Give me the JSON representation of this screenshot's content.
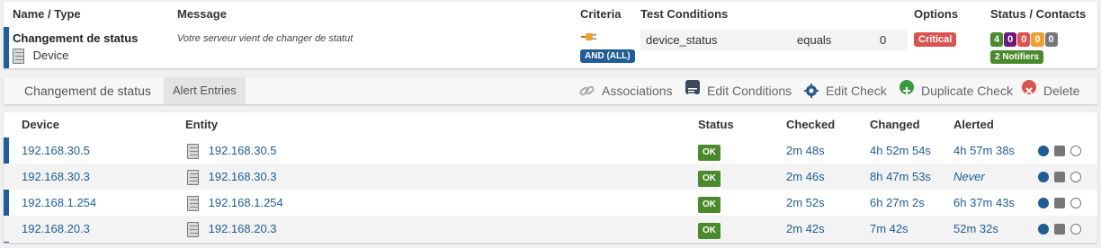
{
  "alert_check": {
    "headers": {
      "name_type": "Name / Type",
      "message": "Message",
      "criteria": "Criteria",
      "test_conditions": "Test Conditions",
      "options": "Options",
      "status_contacts": "Status / Contacts"
    },
    "name": "Changement de status",
    "type": "Device",
    "message": "Votre serveur vient de changer de statut",
    "criteria_badge": "AND (ALL)",
    "condition": {
      "field": "device_status",
      "operator": "equals",
      "value": "0"
    },
    "option_badge": "Critical",
    "status_counts": [
      {
        "value": "4",
        "color": "#4a8a2c"
      },
      {
        "value": "0",
        "color": "#6a1a7a"
      },
      {
        "value": "0",
        "color": "#e0504f"
      },
      {
        "value": "0",
        "color": "#f0a030"
      },
      {
        "value": "0",
        "color": "#777777"
      }
    ],
    "notifiers_badge": "2 Notifiers"
  },
  "nav": {
    "title": "Changement de status",
    "active_tab": "Alert Entries",
    "actions": {
      "associations": "Associations",
      "edit_conditions": "Edit Conditions",
      "edit_check": "Edit Check",
      "duplicate_check": "Duplicate Check",
      "delete": "Delete"
    }
  },
  "table": {
    "columns": {
      "device": "Device",
      "entity": "Entity",
      "status": "Status",
      "checked": "Checked",
      "changed": "Changed",
      "alerted": "Alerted"
    },
    "rows": [
      {
        "device": "192.168.30.5",
        "entity": "192.168.30.5",
        "status": "OK",
        "checked": "2m 48s",
        "changed": "4h 52m 54s",
        "alerted": "4h 57m 38s"
      },
      {
        "device": "192.168.30.3",
        "entity": "192.168.30.3",
        "status": "OK",
        "checked": "2m 46s",
        "changed": "8h 47m 53s",
        "alerted": "Never"
      },
      {
        "device": "192.168.1.254",
        "entity": "192.168.1.254",
        "status": "OK",
        "checked": "2m 52s",
        "changed": "6h 27m 2s",
        "alerted": "6h 37m 43s"
      },
      {
        "device": "192.168.20.3",
        "entity": "192.168.20.3",
        "status": "OK",
        "checked": "2m 42s",
        "changed": "7m 42s",
        "alerted": "52m 32s"
      }
    ]
  },
  "colors": {
    "accent": "#1f5d94",
    "ok": "#4a8a2c",
    "critical": "#d9534f",
    "criteria_badge": "#1f5d94"
  }
}
